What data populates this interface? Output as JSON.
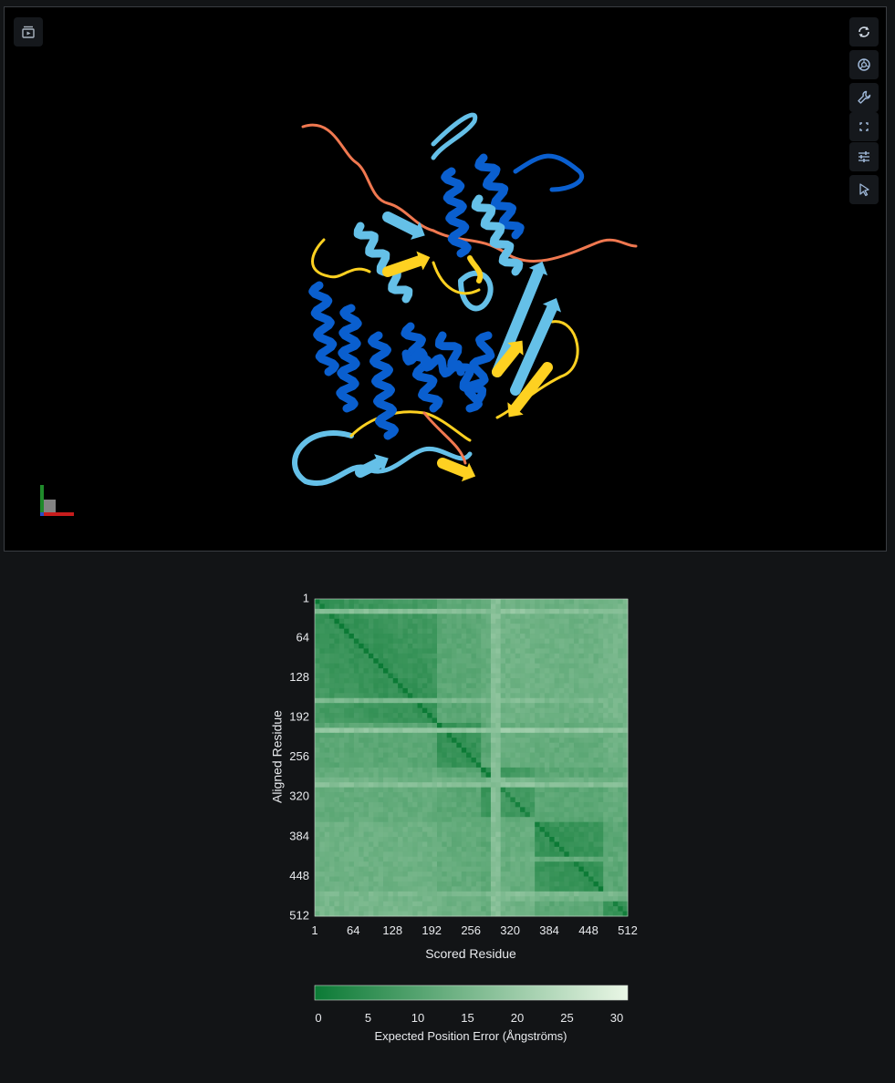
{
  "viewer": {
    "toolbar_left": [
      {
        "icon": "sequence-player-icon"
      }
    ],
    "toolbar_right": [
      {
        "icon": "reset-rotate-icon"
      },
      {
        "icon": "camera-icon"
      },
      {
        "icon": "wrench-icon"
      },
      {
        "icon": "fullscreen-icon"
      },
      {
        "icon": "settings-sliders-icon"
      },
      {
        "icon": "pointer-icon"
      }
    ],
    "colors": {
      "very_high": "#0a5fcf",
      "confident": "#65c0e8",
      "low": "#fed121",
      "very_low": "#f07850"
    }
  },
  "pae": {
    "ylabel": "Aligned Residue",
    "xlabel": "Scored Residue",
    "colorbar_label": "Expected Position Error (Ångströms)"
  },
  "chart_data": [
    {
      "type": "heatmap",
      "title": "",
      "xlabel": "Scored Residue",
      "ylabel": "Aligned Residue",
      "x_ticks": [
        "1",
        "64",
        "128",
        "192",
        "256",
        "320",
        "384",
        "448",
        "512"
      ],
      "y_ticks": [
        "1",
        "64",
        "128",
        "192",
        "256",
        "320",
        "384",
        "448",
        "512"
      ],
      "xlim": [
        1,
        512
      ],
      "ylim": [
        1,
        512
      ],
      "colorbar": {
        "label": "Expected Position Error (Ångströms)",
        "range": [
          0,
          30
        ],
        "ticks": [
          "0",
          "5",
          "10",
          "15",
          "20",
          "25",
          "30"
        ],
        "colors": [
          "#0b7a35",
          "#eaf7e6"
        ]
      }
    }
  ]
}
